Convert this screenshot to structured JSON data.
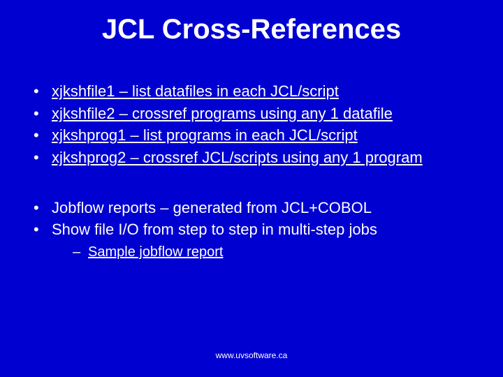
{
  "title": "JCL Cross-References",
  "links": {
    "l1": "xjkshfile1 – list datafiles in each JCL/script",
    "l2": "xjkshfile2 – crossref programs using any 1 datafile",
    "l3": "xjkshprog1 – list programs in each JCL/script",
    "l4": "xjkshprog2 – crossref JCL/scripts using any 1 program"
  },
  "bullets": {
    "b5": "Jobflow reports – generated from JCL+COBOL",
    "b6": "Show file I/O from step to step in multi-step jobs"
  },
  "sublink": "Sample jobflow report",
  "footer": "www.uvsoftware.ca"
}
